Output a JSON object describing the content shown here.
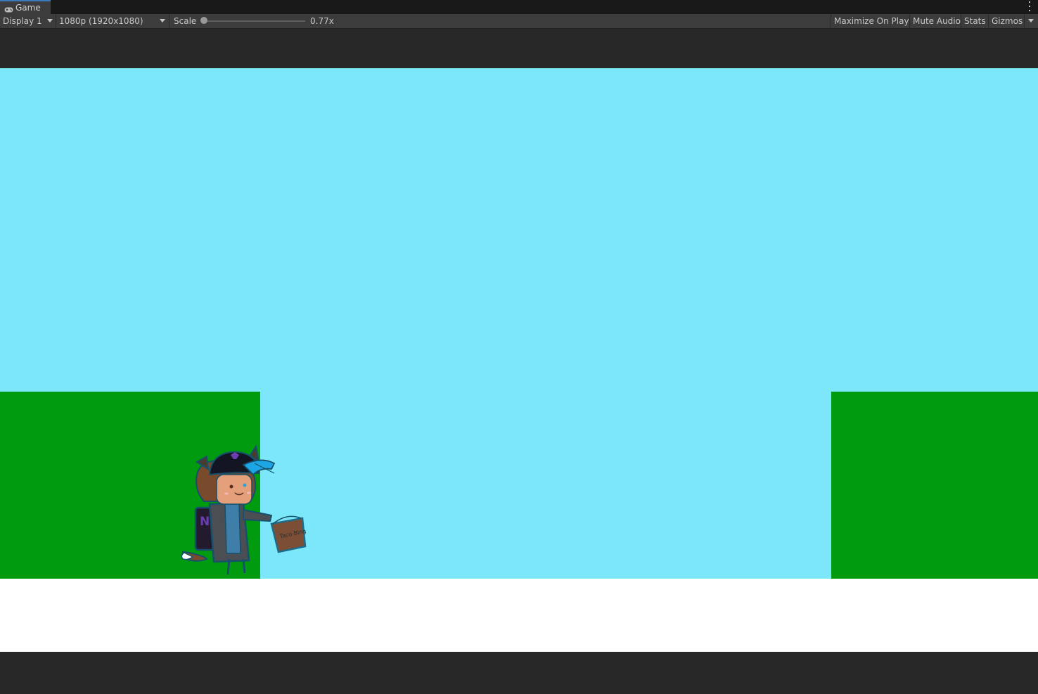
{
  "tab": {
    "label": "Game",
    "icon": "gamepad-icon"
  },
  "toolbar": {
    "display": "Display 1",
    "resolution": "1080p (1920x1080)",
    "scale_label": "Scale",
    "scale_value": "0.77x",
    "scale_fraction": 0.0,
    "maximize_on_play": "Maximize On Play",
    "mute_audio": "Mute Audio",
    "stats": "Stats",
    "gizmos": "Gizmos"
  },
  "scene": {
    "sky_color": "#7be7f8",
    "ground_color": "#009b0e",
    "floor_color": "#ffffff",
    "character": {
      "backpack_text": "NE",
      "bag_text": "Taco Bing"
    }
  }
}
